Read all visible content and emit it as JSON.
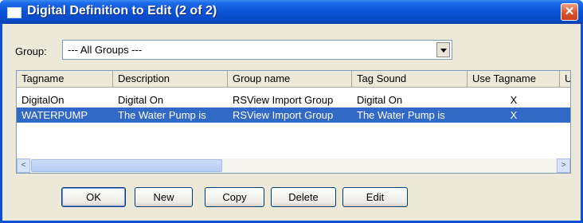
{
  "window": {
    "title": "Digital Definition to Edit (2 of 2)"
  },
  "group": {
    "label": "Group:",
    "value": "--- All Groups ---"
  },
  "table": {
    "columns": [
      "Tagname",
      "Description",
      "Group name",
      "Tag Sound",
      "Use Tagname",
      "U"
    ],
    "rows": [
      {
        "tagname": "DigitalOn",
        "description": "Digital On",
        "group": "RSView Import Group",
        "sound": "Digital On",
        "use_tagname": "X",
        "selected": false
      },
      {
        "tagname": "WATERPUMP",
        "description": "The Water Pump is",
        "group": "RSView Import Group",
        "sound": "The Water Pump is",
        "use_tagname": "X",
        "selected": true
      }
    ]
  },
  "scrollbar": {
    "left_arrow": "<",
    "right_arrow": ">"
  },
  "buttons": {
    "ok": "OK",
    "new": "New",
    "copy": "Copy",
    "delete": "Delete",
    "edit": "Edit"
  },
  "icons": {
    "close": "close-icon",
    "app": "window-icon",
    "dropdown": "chevron-down-icon"
  },
  "colors": {
    "titlebar": "#0a52d6",
    "selection": "#3169c6",
    "close": "#d8532b"
  }
}
